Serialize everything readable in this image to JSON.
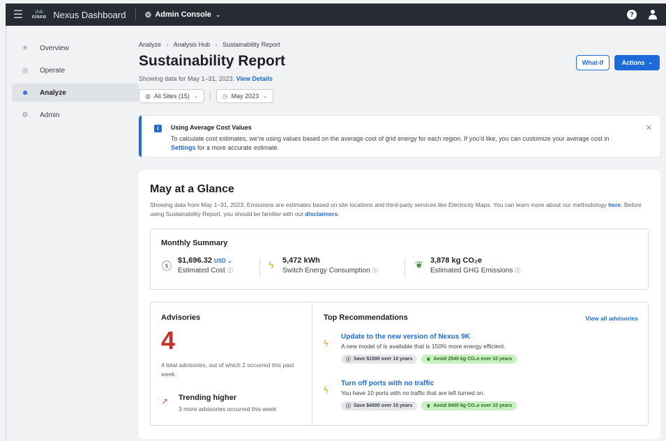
{
  "topbar": {
    "logo_text": "cisco",
    "product": "Nexus Dashboard",
    "console": "Admin Console"
  },
  "sidebar": {
    "items": [
      {
        "label": "Overview",
        "icon": "overview-icon"
      },
      {
        "label": "Operate",
        "icon": "operate-icon"
      },
      {
        "label": "Analyze",
        "icon": "analyze-icon",
        "active": true
      },
      {
        "label": "Admin",
        "icon": "admin-icon"
      }
    ]
  },
  "breadcrumb": [
    "Analyze",
    "Analysis Hub",
    "Sustainability Report"
  ],
  "page": {
    "title": "Sustainability Report",
    "subtitle": "Showing data for May 1–31, 2023.",
    "view_details": "View Details",
    "what_if": "What-If",
    "actions": "Actions"
  },
  "filters": {
    "sites": "All Sites (15)",
    "month": "May 2023"
  },
  "banner": {
    "title": "Using Average Cost Values",
    "text_before": "To calculate cost estimates, we’re using values based on the average cost of grid energy for each region. If you’d like, you can customize your average cost in",
    "settings_link": "Settings",
    "text_after": "for a more accurate estimate."
  },
  "glance": {
    "title": "May at a Glance",
    "text_1": "Showing data from May 1–31, 2023. Emissions are estimates based on site locations and third-party services like Electricity Maps. You can learn more about our methodology",
    "link_here": "here",
    "text_2": ". Before using Sustainability Report, you should be familiar with our",
    "link_disclaimers": "disclaimers",
    "text_3": "."
  },
  "summary": {
    "title": "Monthly Summary",
    "cost_value": "$1,696.32",
    "cost_unit": "USD",
    "cost_label": "Estimated Cost",
    "energy_value": "5,472 kWh",
    "energy_label": "Switch Energy Consumption",
    "emissions_value": "3,878 kg CO₂e",
    "emissions_label": "Estimated GHG Emissions"
  },
  "advisories": {
    "title": "Advisories",
    "count": "4",
    "desc": "4 total advisories, out of which 2 occurred this past week.",
    "trend_title": "Trending higher",
    "trend_sub": "3 more advisories occurred this week"
  },
  "recommendations": {
    "title": "Top Recommendations",
    "view_all": "View all advisories",
    "items": [
      {
        "title": "Update to the new version of Nexus 9K",
        "desc": "A new model of is available that is 150% more energy efficient.",
        "save": "Save $1500 over 10 years",
        "avoid": "Avoid 2540 kg CO₂e over 10 years"
      },
      {
        "title": "Turn off ports with no traffic",
        "desc": "You have 10 ports with no traffic that are left turned on.",
        "save": "Save $4000 over 10 years",
        "avoid": "Avoid 8400 kg CO₂e over 10 years"
      }
    ]
  },
  "colors": {
    "accent": "#1e6ad9",
    "topbar": "#272b33",
    "alert_red": "#c8322c",
    "energy_yellow": "#e3a21a",
    "eco_green": "#2e6b25"
  }
}
